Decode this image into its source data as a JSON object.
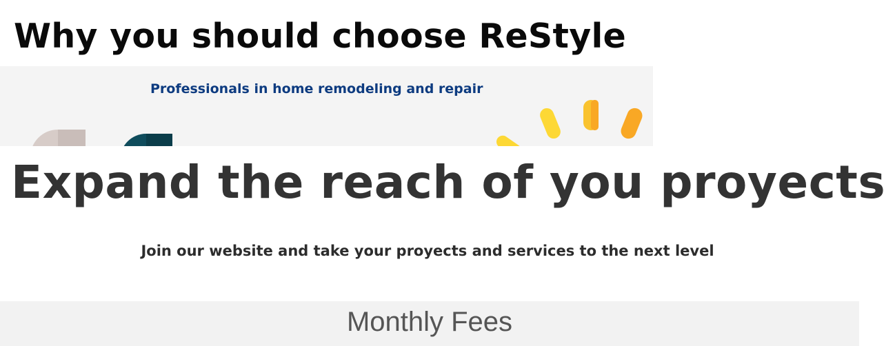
{
  "why_section": {
    "title": "Why you should choose ReStyle"
  },
  "banner": {
    "tagline": "Professionals in home remodeling and repair",
    "tagline_color": "#0d3b80",
    "accent_yellow": "#fdd835",
    "accent_orange": "#f9a825"
  },
  "expand_section": {
    "title": "Expand the reach of you proyects",
    "subtitle": "Join our website and take your proyects and services to the next level"
  },
  "fees_section": {
    "title": "Monthly Fees"
  }
}
